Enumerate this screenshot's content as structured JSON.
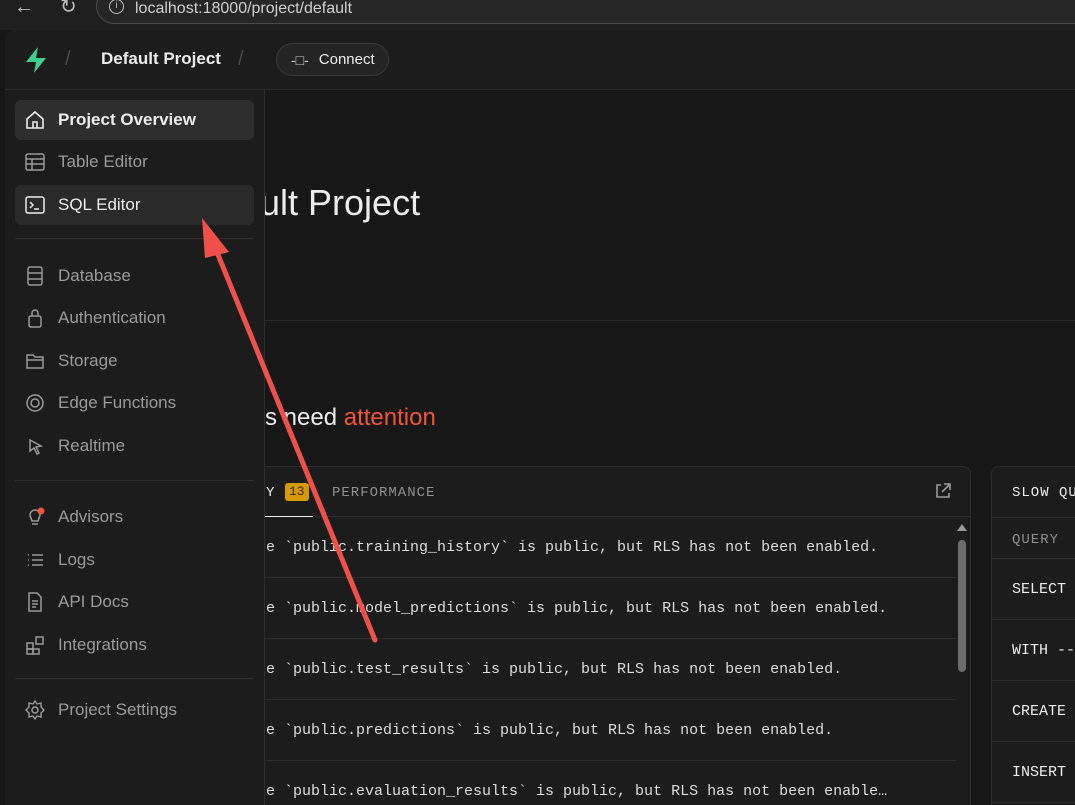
{
  "browser": {
    "url": "localhost:18000/project/default"
  },
  "header": {
    "project_name": "Default Project",
    "connect_label": "Connect"
  },
  "sidebar": {
    "items": [
      {
        "label": "Project Overview",
        "icon": "home-icon"
      },
      {
        "label": "Table Editor",
        "icon": "table-icon"
      },
      {
        "label": "SQL Editor",
        "icon": "terminal-icon"
      },
      {
        "label": "Database",
        "icon": "database-icon"
      },
      {
        "label": "Authentication",
        "icon": "lock-icon"
      },
      {
        "label": "Storage",
        "icon": "folder-icon"
      },
      {
        "label": "Edge Functions",
        "icon": "edge-functions-icon"
      },
      {
        "label": "Realtime",
        "icon": "cursor-icon"
      },
      {
        "label": "Advisors",
        "icon": "lightbulb-icon"
      },
      {
        "label": "Logs",
        "icon": "list-icon"
      },
      {
        "label": "API Docs",
        "icon": "document-icon"
      },
      {
        "label": "Integrations",
        "icon": "blocks-icon"
      },
      {
        "label": "Project Settings",
        "icon": "gear-icon"
      }
    ]
  },
  "main": {
    "title": "ult Project",
    "attention_prefix": "s need ",
    "attention_word": "attention",
    "issues_card": {
      "security_tab": "Y",
      "security_count": "13",
      "performance_tab": "PERFORMANCE",
      "issues": [
        "e `public.training_history` is public, but RLS has not been enabled.",
        "e `public.model_predictions` is public, but RLS has not been enabled.",
        "e `public.test_results` is public, but RLS has not been enabled.",
        "e `public.predictions` is public, but RLS has not been enabled.",
        "e `public.evaluation_results` is public, but RLS has not been enable…"
      ]
    },
    "slow_queries_card": {
      "title": "SLOW QU",
      "column_header": "QUERY",
      "rows": [
        "SELECT",
        "WITH --",
        "CREATE",
        "INSERT"
      ]
    }
  },
  "colors": {
    "accent_green": "#3ecf8e",
    "attention_red": "#f0553a",
    "annotation_arrow": "#f0504a",
    "badge_amber": "#d49a04"
  }
}
